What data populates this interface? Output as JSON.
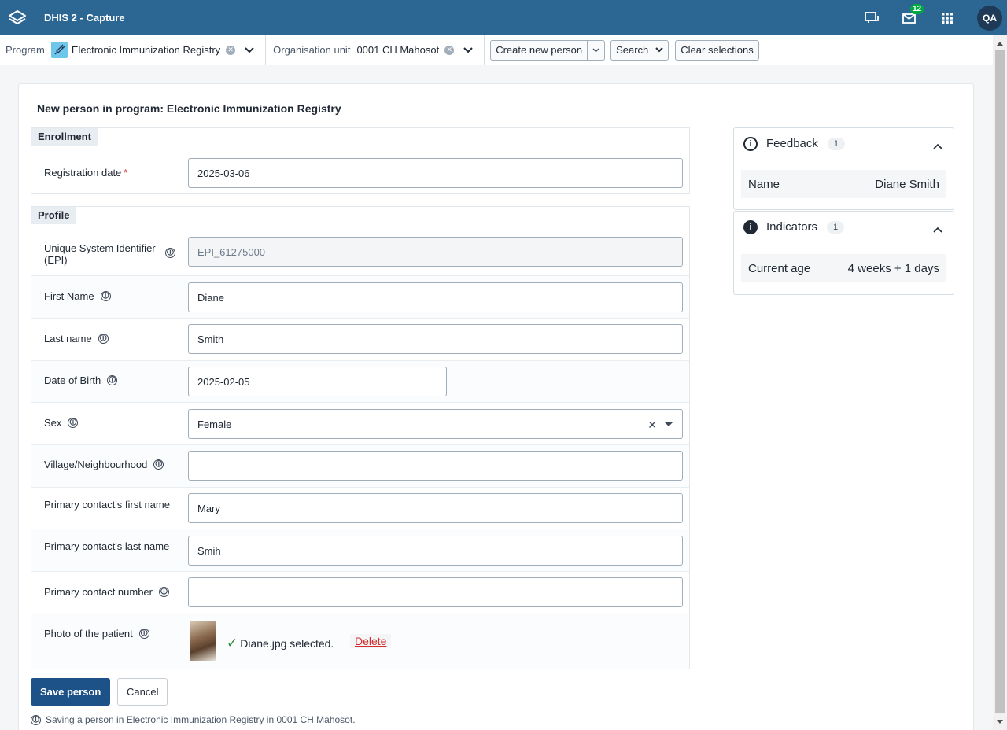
{
  "header": {
    "app_title": "DHIS 2 - Capture",
    "messages_count": "12",
    "user_initials": "QA"
  },
  "selection_bar": {
    "program_label": "Program",
    "program_value": "Electronic Immunization Registry",
    "org_unit_label": "Organisation unit",
    "org_unit_value": "0001 CH Mahosot",
    "create_new_label": "Create new person",
    "search_label": "Search",
    "clear_label": "Clear selections"
  },
  "page": {
    "title": "New person in program: Electronic Immunization Registry"
  },
  "enrollment": {
    "section_label": "Enrollment",
    "registration_date_label": "Registration date",
    "required_mark": "*",
    "registration_date_value": "2025-03-06"
  },
  "profile": {
    "section_label": "Profile",
    "fields": {
      "epi": {
        "label": "Unique System Identifier (EPI)",
        "value": "EPI_61275000"
      },
      "first_name": {
        "label": "First Name",
        "value": "Diane"
      },
      "last_name": {
        "label": "Last name",
        "value": "Smith"
      },
      "dob": {
        "label": "Date of Birth",
        "value": "2025-02-05"
      },
      "sex": {
        "label": "Sex",
        "value": "Female"
      },
      "village": {
        "label": "Village/Neighbourhood",
        "value": ""
      },
      "contact_first": {
        "label": "Primary contact's first name",
        "value": "Mary"
      },
      "contact_last": {
        "label": "Primary contact's last name",
        "value": "Smih"
      },
      "contact_number": {
        "label": "Primary contact number",
        "value": ""
      },
      "photo": {
        "label": "Photo of the patient",
        "status": "Diane.jpg selected.",
        "delete_label": "Delete"
      }
    }
  },
  "actions": {
    "save_label": "Save person",
    "cancel_label": "Cancel",
    "save_note": "Saving a person in Electronic Immunization Registry in 0001 CH Mahosot."
  },
  "feedback_widget": {
    "title": "Feedback",
    "count": "1",
    "row_key": "Name",
    "row_value": "Diane Smith"
  },
  "indicators_widget": {
    "title": "Indicators",
    "count": "1",
    "row_key": "Current age",
    "row_value": "4 weeks + 1 days"
  },
  "icons": {
    "info_glyph": "🛈"
  },
  "colors": {
    "header_bg": "#2c6693",
    "primary_button": "#1d5288",
    "badge": "#00a941",
    "required": "#d32f2f",
    "success_check": "#2f8f38"
  }
}
